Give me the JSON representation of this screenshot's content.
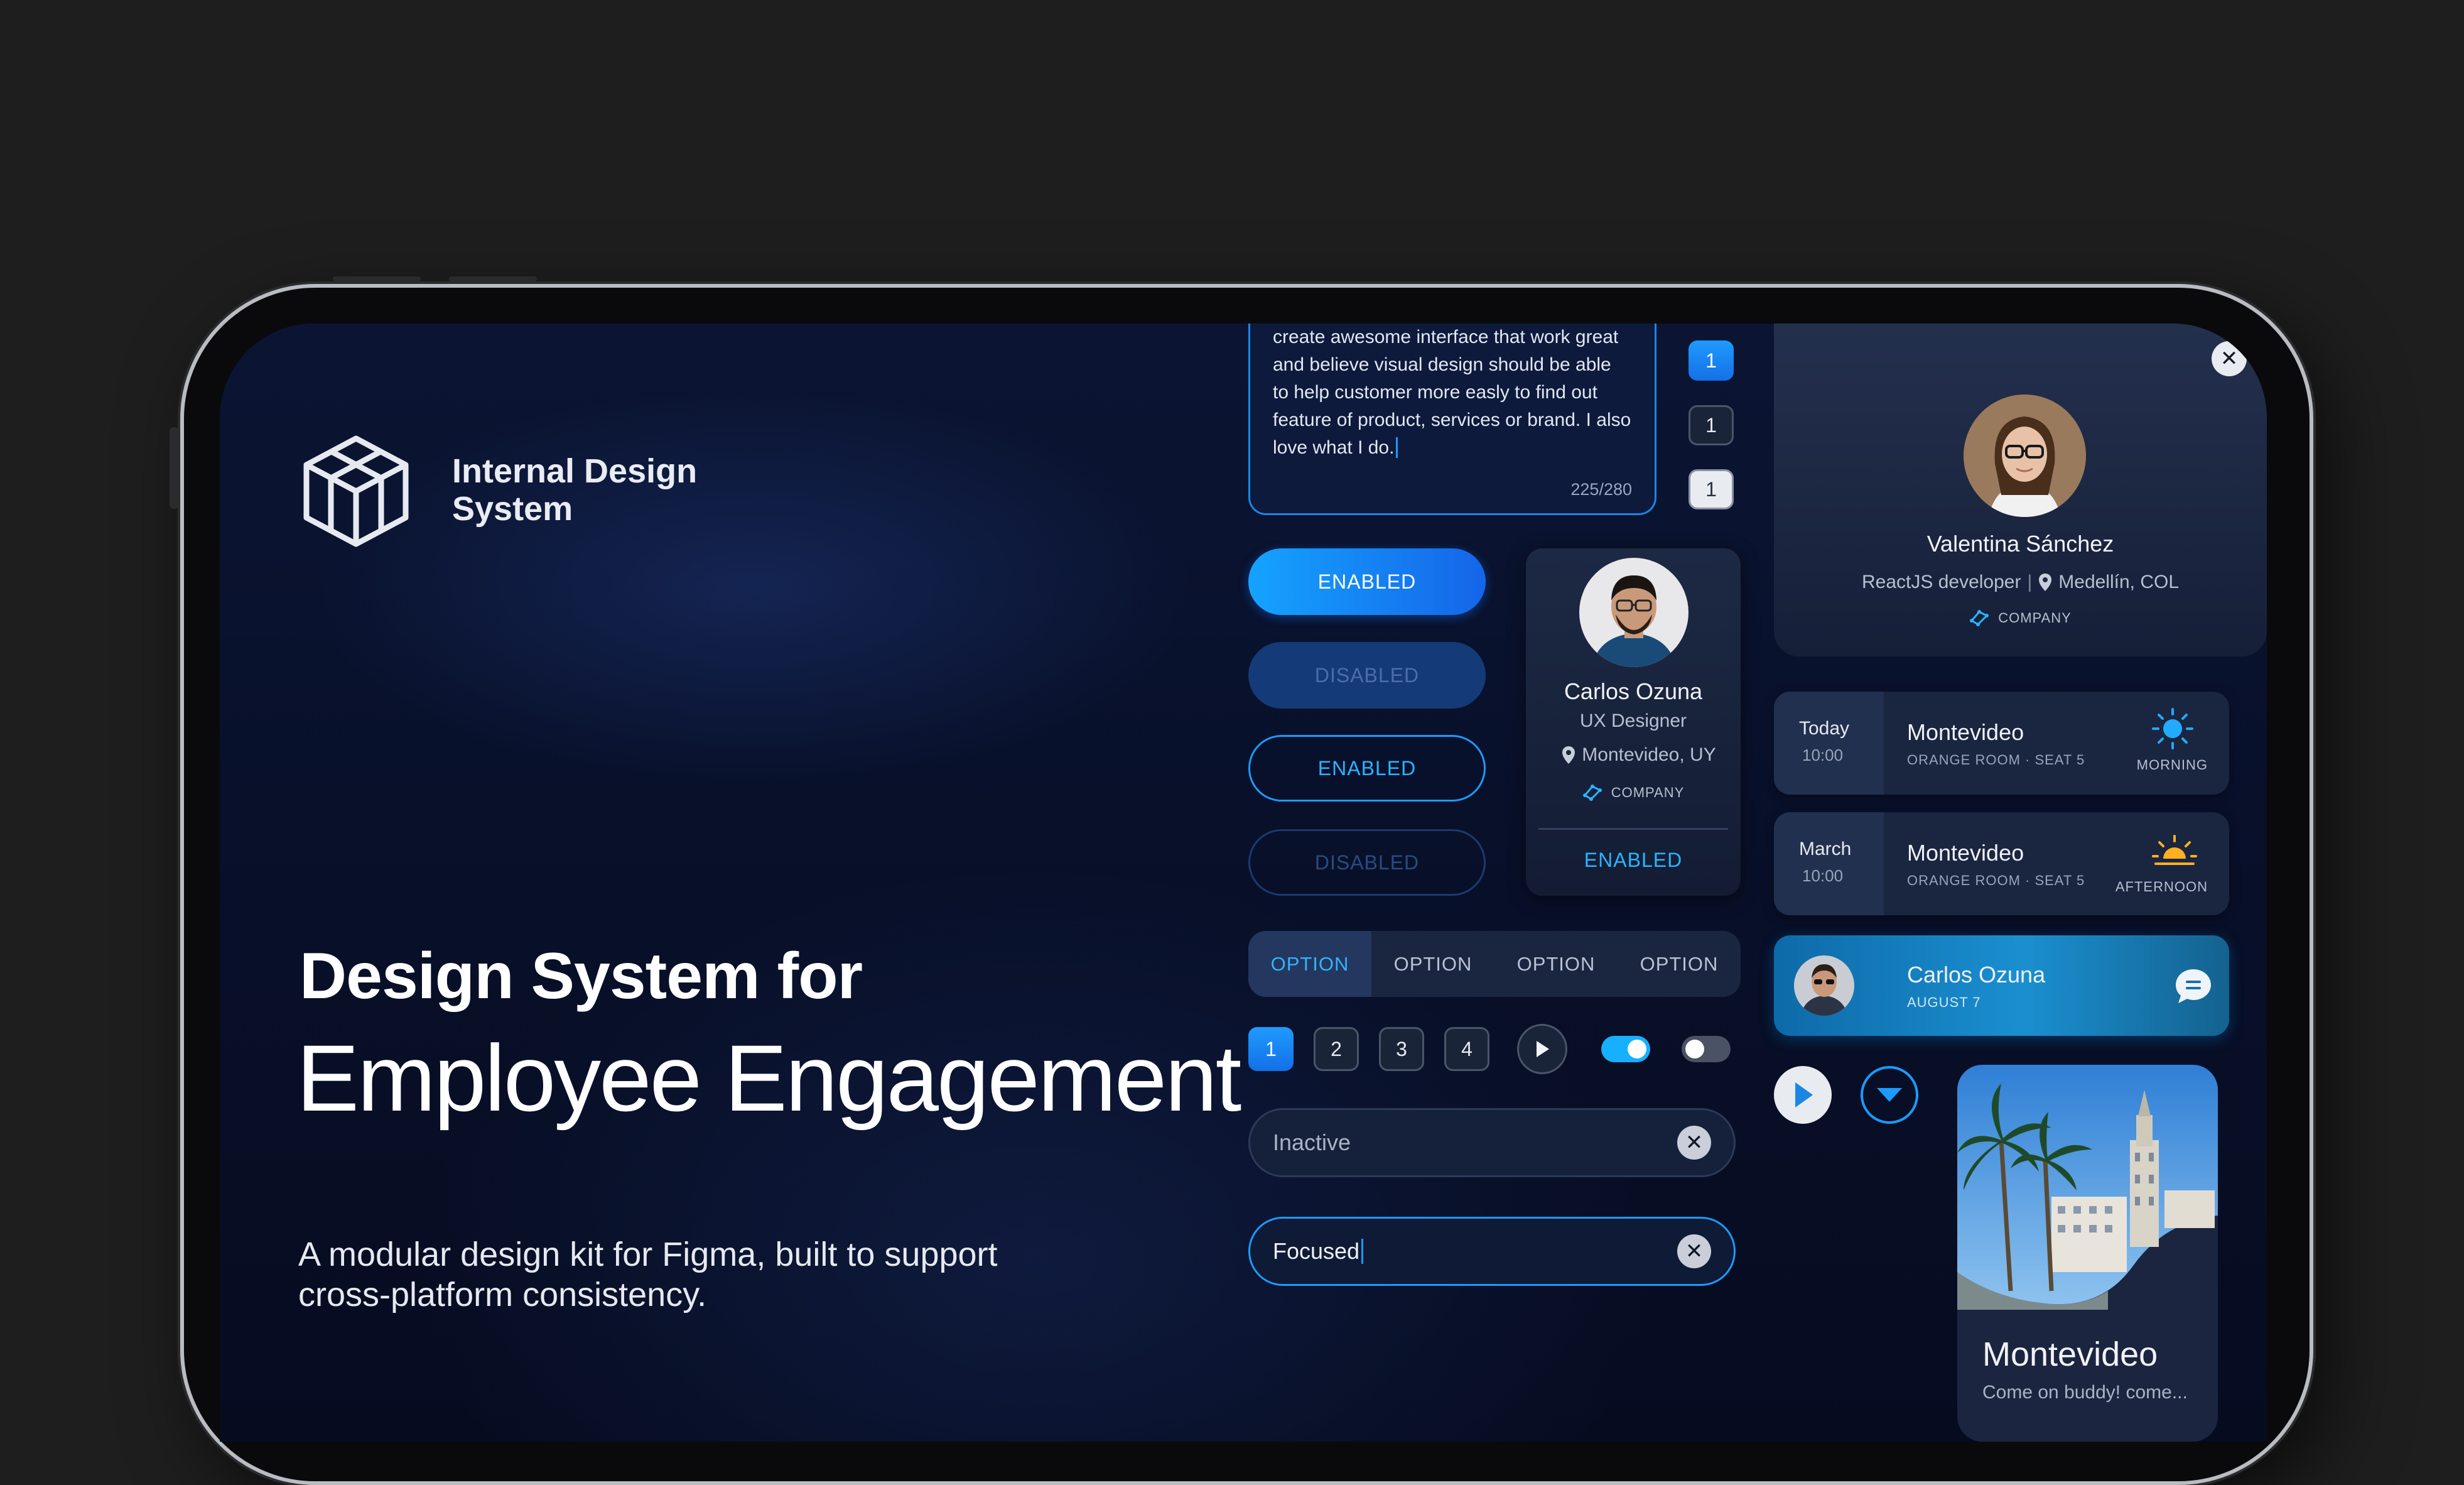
{
  "hero": {
    "logo_text": "Internal Design\nSystem",
    "title_line1": "Design System for",
    "title_line2": "Employee Engagement",
    "description": "A modular design kit for Figma, built to support cross-platform consistency."
  },
  "textarea": {
    "value": "create awesome interface that work great and believe visual design should be able to help customer more easly to find out feature of product, services or brand. I also love what I do.",
    "counter": "225/280"
  },
  "pager_vertical": [
    "1",
    "1",
    "1"
  ],
  "buttons": {
    "filled_enabled": "ENABLED",
    "filled_disabled": "DISABLED",
    "outline_enabled": "ENABLED",
    "outline_disabled": "DISABLED"
  },
  "profile_card": {
    "name": "Carlos Ozuna",
    "role": "UX Designer",
    "location": "Montevideo, UY",
    "company": "COMPANY",
    "action": "ENABLED"
  },
  "segmented": [
    "OPTION",
    "OPTION",
    "OPTION",
    "OPTION"
  ],
  "pagination": [
    "1",
    "2",
    "3",
    "4"
  ],
  "inputs": {
    "inactive_value": "Inactive",
    "focused_value": "Focused"
  },
  "top_profile": {
    "name": "Valentina Sánchez",
    "role": "ReactJS developer",
    "separator": "|",
    "location": "Medellín, COL",
    "company": "COMPANY"
  },
  "events": [
    {
      "when": "Today",
      "time": "10:00",
      "title": "Montevideo",
      "sub": "ORANGE ROOM · SEAT 5",
      "tag": "MORNING"
    },
    {
      "when": "March",
      "time": "10:00",
      "title": "Montevideo",
      "sub": "ORANGE ROOM · SEAT 5",
      "tag": "AFTERNOON"
    }
  ],
  "chat": {
    "name": "Carlos Ozuna",
    "date": "AUGUST 7"
  },
  "city_card": {
    "title": "Montevideo",
    "subtitle": "Come on buddy! come..."
  },
  "colors": {
    "accent": "#1b9bff",
    "background": "#08102a",
    "sun_morning": "#22aaff",
    "sun_afternoon": "#ffb020"
  }
}
